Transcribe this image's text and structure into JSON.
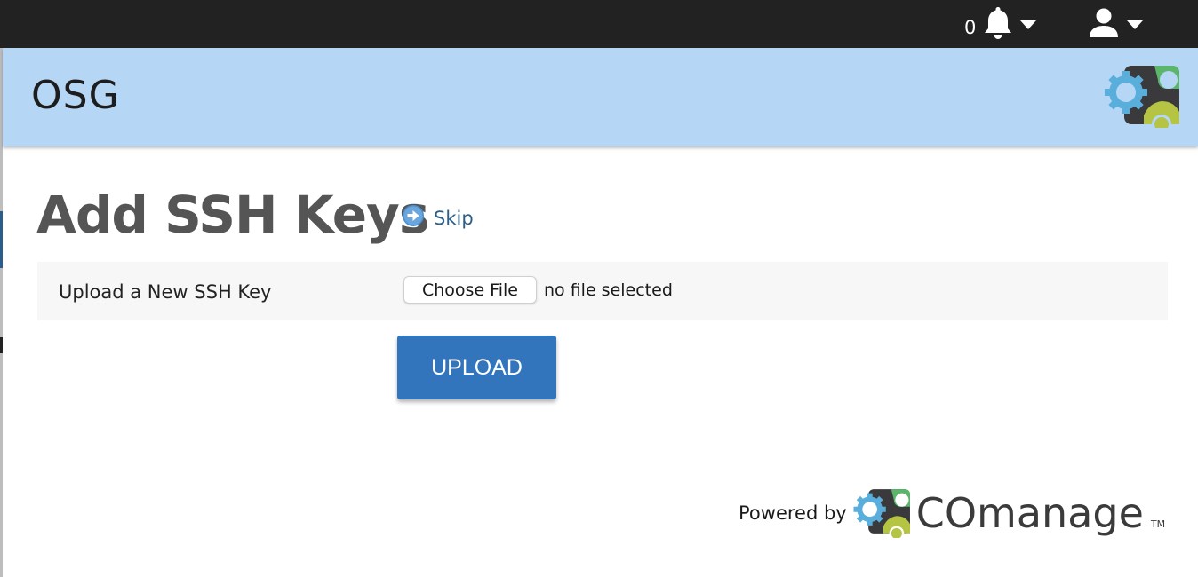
{
  "topbar": {
    "notification_count": "0",
    "notification_icon": "bell-icon",
    "notification_menu_icon": "caret-down-icon",
    "user_icon": "user-icon",
    "user_menu_icon": "caret-down-icon"
  },
  "banner": {
    "title": "OSG",
    "logo_icon": "comanage-gears-logo"
  },
  "page": {
    "title": "Add SSH Keys",
    "skip_icon": "arrow-circle-right-icon",
    "skip_label": "Skip"
  },
  "form": {
    "label": "Upload a New SSH Key",
    "choose_file_label": "Choose File",
    "file_status": "no file selected",
    "upload_label": "UPLOAD"
  },
  "footer": {
    "powered_by": "Powered by",
    "brand": "COmanage",
    "trademark": "TM"
  },
  "colors": {
    "topbar_bg": "#222222",
    "banner_bg": "#b5d7f5",
    "primary_button": "#3375bd",
    "link": "#2b5f8a",
    "title": "#555555",
    "form_row_bg": "#f7f7f7"
  }
}
